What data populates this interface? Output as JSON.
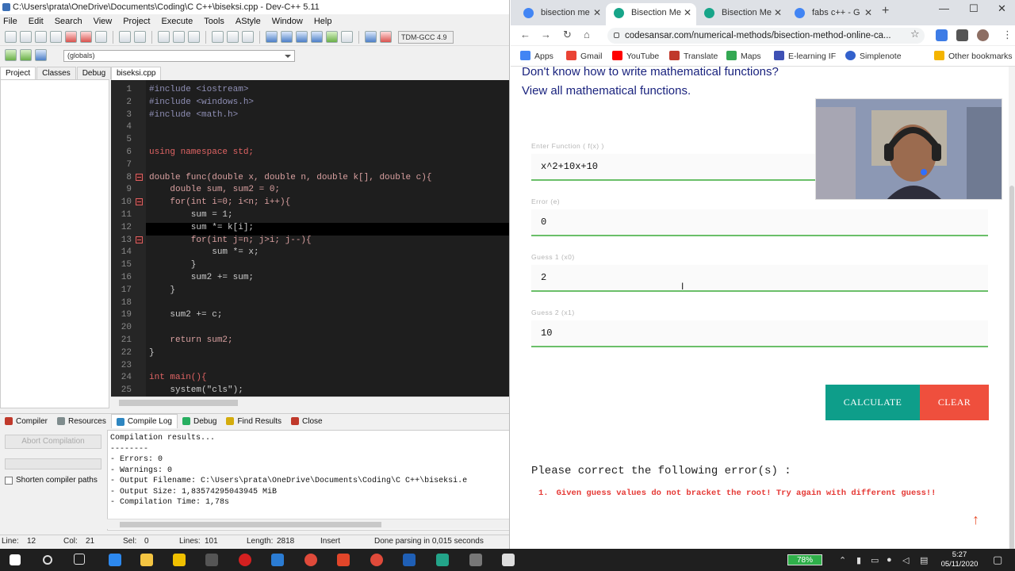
{
  "ide": {
    "title": "C:\\Users\\prata\\OneDrive\\Documents\\Coding\\C C++\\biseksi.cpp - Dev-C++ 5.11",
    "menu": [
      "File",
      "Edit",
      "Search",
      "View",
      "Project",
      "Execute",
      "Tools",
      "AStyle",
      "Window",
      "Help"
    ],
    "compiler": "TDM-GCC 4.9",
    "globals": "(globals)",
    "left_tabs": [
      "Project",
      "Classes",
      "Debug"
    ],
    "file_tab": "biseksi.cpp",
    "line_numbers": [
      "1",
      "2",
      "3",
      "4",
      "5",
      "6",
      "7",
      "8",
      "9",
      "10",
      "11",
      "12",
      "13",
      "14",
      "15",
      "16",
      "17",
      "18",
      "19",
      "20",
      "21",
      "22",
      "23",
      "24",
      "25"
    ],
    "code_lines": [
      "#include <iostream>",
      "#include <windows.h>",
      "#include <math.h>",
      "",
      "",
      "using namespace std;",
      "",
      "double func(double x, double n, double k[], double c){",
      "    double sum, sum2 = 0;",
      "    for(int i=0; i<n; i++){",
      "        sum = 1;",
      "        sum *= k[i];",
      "        for(int j=n; j>i; j--){",
      "            sum *= x;",
      "        }",
      "        sum2 += sum;",
      "    }",
      "",
      "    sum2 += c;",
      "",
      "    return sum2;",
      "}",
      "",
      "int main(){",
      "    system(\"cls\");"
    ],
    "bottom_tabs": [
      "Compiler",
      "Resources",
      "Compile Log",
      "Debug",
      "Find Results",
      "Close"
    ],
    "abort_label": "Abort Compilation",
    "shorten_label": "Shorten compiler paths",
    "log_lines": [
      "Compilation results...",
      "--------",
      "- Errors: 0",
      "- Warnings: 0",
      "- Output Filename: C:\\Users\\prata\\OneDrive\\Documents\\Coding\\C C++\\biseksi.e",
      "- Output Size: 1,83574295043945 MiB",
      "- Compilation Time: 1,78s"
    ],
    "status": {
      "line": "Line:",
      "line_val": "12",
      "col": "Col:",
      "col_val": "21",
      "sel": "Sel:",
      "sel_val": "0",
      "lines": "Lines:",
      "lines_val": "101",
      "length": "Length:",
      "length_val": "2818",
      "mode": "Insert",
      "message": "Done parsing in 0,015 seconds"
    }
  },
  "browser": {
    "tabs": [
      {
        "title": "bisection me",
        "favicon_color": "#4285f4"
      },
      {
        "title": "Bisection Me",
        "favicon_color": "#17a589"
      },
      {
        "title": "Bisection Me",
        "favicon_color": "#17a589"
      },
      {
        "title": "fabs c++ - G",
        "favicon_color": "#4285f4"
      }
    ],
    "url": "codesansar.com/numerical-methods/bisection-method-online-ca...",
    "bookmarks": [
      "Apps",
      "Gmail",
      "YouTube",
      "Translate",
      "Maps",
      "E-learning IF",
      "Simplenote",
      "Other bookmarks"
    ],
    "page": {
      "question": "Don't know how to write mathematical functions?",
      "view_link": "View all mathematical functions.",
      "fields": [
        {
          "label": "Enter Function ( f(x) )",
          "value": "x^2+10x+10"
        },
        {
          "label": "Error (e)",
          "value": "0"
        },
        {
          "label": "Guess 1 (x0)",
          "value": "2"
        },
        {
          "label": "Guess 2 (x1)",
          "value": "10"
        }
      ],
      "calculate": "CALCULATE",
      "clear": "CLEAR",
      "error_title": "Please correct the following error(s) :",
      "error_num": "1.",
      "error_msg": "Given guess values do not bracket the root! Try again with different guess!!"
    }
  },
  "taskbar": {
    "battery": "78%",
    "time": "5:27",
    "date": "05/11/2020"
  }
}
